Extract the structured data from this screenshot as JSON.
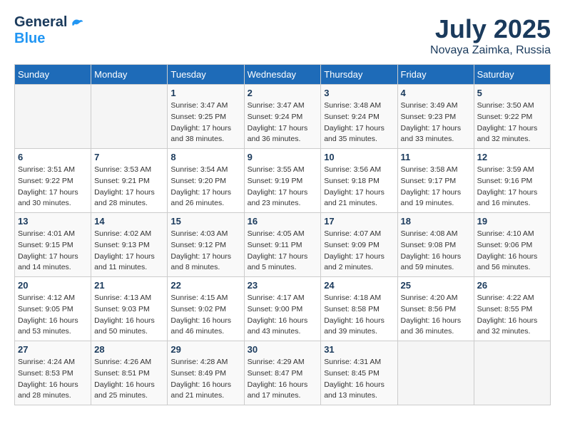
{
  "logo": {
    "general": "General",
    "blue": "Blue"
  },
  "title": {
    "month": "July 2025",
    "location": "Novaya Zaimka, Russia"
  },
  "weekdays": [
    "Sunday",
    "Monday",
    "Tuesday",
    "Wednesday",
    "Thursday",
    "Friday",
    "Saturday"
  ],
  "weeks": [
    [
      {
        "day": "",
        "info": ""
      },
      {
        "day": "",
        "info": ""
      },
      {
        "day": "1",
        "info": "Sunrise: 3:47 AM\nSunset: 9:25 PM\nDaylight: 17 hours\nand 38 minutes."
      },
      {
        "day": "2",
        "info": "Sunrise: 3:47 AM\nSunset: 9:24 PM\nDaylight: 17 hours\nand 36 minutes."
      },
      {
        "day": "3",
        "info": "Sunrise: 3:48 AM\nSunset: 9:24 PM\nDaylight: 17 hours\nand 35 minutes."
      },
      {
        "day": "4",
        "info": "Sunrise: 3:49 AM\nSunset: 9:23 PM\nDaylight: 17 hours\nand 33 minutes."
      },
      {
        "day": "5",
        "info": "Sunrise: 3:50 AM\nSunset: 9:22 PM\nDaylight: 17 hours\nand 32 minutes."
      }
    ],
    [
      {
        "day": "6",
        "info": "Sunrise: 3:51 AM\nSunset: 9:22 PM\nDaylight: 17 hours\nand 30 minutes."
      },
      {
        "day": "7",
        "info": "Sunrise: 3:53 AM\nSunset: 9:21 PM\nDaylight: 17 hours\nand 28 minutes."
      },
      {
        "day": "8",
        "info": "Sunrise: 3:54 AM\nSunset: 9:20 PM\nDaylight: 17 hours\nand 26 minutes."
      },
      {
        "day": "9",
        "info": "Sunrise: 3:55 AM\nSunset: 9:19 PM\nDaylight: 17 hours\nand 23 minutes."
      },
      {
        "day": "10",
        "info": "Sunrise: 3:56 AM\nSunset: 9:18 PM\nDaylight: 17 hours\nand 21 minutes."
      },
      {
        "day": "11",
        "info": "Sunrise: 3:58 AM\nSunset: 9:17 PM\nDaylight: 17 hours\nand 19 minutes."
      },
      {
        "day": "12",
        "info": "Sunrise: 3:59 AM\nSunset: 9:16 PM\nDaylight: 17 hours\nand 16 minutes."
      }
    ],
    [
      {
        "day": "13",
        "info": "Sunrise: 4:01 AM\nSunset: 9:15 PM\nDaylight: 17 hours\nand 14 minutes."
      },
      {
        "day": "14",
        "info": "Sunrise: 4:02 AM\nSunset: 9:13 PM\nDaylight: 17 hours\nand 11 minutes."
      },
      {
        "day": "15",
        "info": "Sunrise: 4:03 AM\nSunset: 9:12 PM\nDaylight: 17 hours\nand 8 minutes."
      },
      {
        "day": "16",
        "info": "Sunrise: 4:05 AM\nSunset: 9:11 PM\nDaylight: 17 hours\nand 5 minutes."
      },
      {
        "day": "17",
        "info": "Sunrise: 4:07 AM\nSunset: 9:09 PM\nDaylight: 17 hours\nand 2 minutes."
      },
      {
        "day": "18",
        "info": "Sunrise: 4:08 AM\nSunset: 9:08 PM\nDaylight: 16 hours\nand 59 minutes."
      },
      {
        "day": "19",
        "info": "Sunrise: 4:10 AM\nSunset: 9:06 PM\nDaylight: 16 hours\nand 56 minutes."
      }
    ],
    [
      {
        "day": "20",
        "info": "Sunrise: 4:12 AM\nSunset: 9:05 PM\nDaylight: 16 hours\nand 53 minutes."
      },
      {
        "day": "21",
        "info": "Sunrise: 4:13 AM\nSunset: 9:03 PM\nDaylight: 16 hours\nand 50 minutes."
      },
      {
        "day": "22",
        "info": "Sunrise: 4:15 AM\nSunset: 9:02 PM\nDaylight: 16 hours\nand 46 minutes."
      },
      {
        "day": "23",
        "info": "Sunrise: 4:17 AM\nSunset: 9:00 PM\nDaylight: 16 hours\nand 43 minutes."
      },
      {
        "day": "24",
        "info": "Sunrise: 4:18 AM\nSunset: 8:58 PM\nDaylight: 16 hours\nand 39 minutes."
      },
      {
        "day": "25",
        "info": "Sunrise: 4:20 AM\nSunset: 8:56 PM\nDaylight: 16 hours\nand 36 minutes."
      },
      {
        "day": "26",
        "info": "Sunrise: 4:22 AM\nSunset: 8:55 PM\nDaylight: 16 hours\nand 32 minutes."
      }
    ],
    [
      {
        "day": "27",
        "info": "Sunrise: 4:24 AM\nSunset: 8:53 PM\nDaylight: 16 hours\nand 28 minutes."
      },
      {
        "day": "28",
        "info": "Sunrise: 4:26 AM\nSunset: 8:51 PM\nDaylight: 16 hours\nand 25 minutes."
      },
      {
        "day": "29",
        "info": "Sunrise: 4:28 AM\nSunset: 8:49 PM\nDaylight: 16 hours\nand 21 minutes."
      },
      {
        "day": "30",
        "info": "Sunrise: 4:29 AM\nSunset: 8:47 PM\nDaylight: 16 hours\nand 17 minutes."
      },
      {
        "day": "31",
        "info": "Sunrise: 4:31 AM\nSunset: 8:45 PM\nDaylight: 16 hours\nand 13 minutes."
      },
      {
        "day": "",
        "info": ""
      },
      {
        "day": "",
        "info": ""
      }
    ]
  ]
}
